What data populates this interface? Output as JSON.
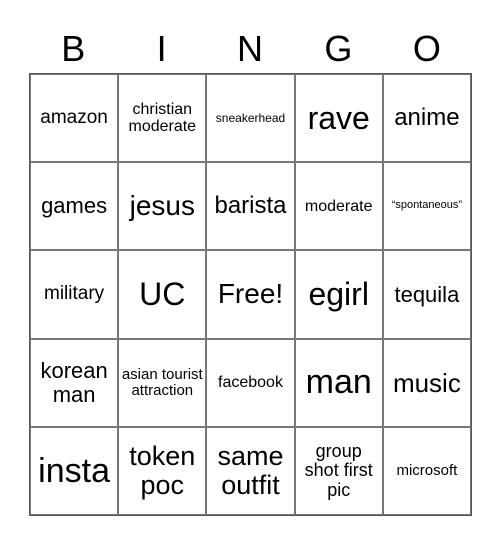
{
  "title_letters": [
    "B",
    "I",
    "N",
    "G",
    "O"
  ],
  "cells": [
    {
      "text": "amazon",
      "size": 19
    },
    {
      "text": "christian moderate",
      "size": 16
    },
    {
      "text": "sneakerhead",
      "size": 12
    },
    {
      "text": "rave",
      "size": 32
    },
    {
      "text": "anime",
      "size": 24
    },
    {
      "text": "games",
      "size": 22
    },
    {
      "text": "jesus",
      "size": 28
    },
    {
      "text": "barista",
      "size": 24
    },
    {
      "text": "moderate",
      "size": 16
    },
    {
      "text": "“spontaneous”",
      "size": 11
    },
    {
      "text": "military",
      "size": 19
    },
    {
      "text": "UC",
      "size": 32
    },
    {
      "text": "Free!",
      "size": 28
    },
    {
      "text": "egirl",
      "size": 32
    },
    {
      "text": "tequila",
      "size": 22
    },
    {
      "text": "korean man",
      "size": 22
    },
    {
      "text": "asian tourist attraction",
      "size": 15
    },
    {
      "text": "facebook",
      "size": 16
    },
    {
      "text": "man",
      "size": 34
    },
    {
      "text": "music",
      "size": 26
    },
    {
      "text": "insta",
      "size": 34
    },
    {
      "text": "token poc",
      "size": 27
    },
    {
      "text": "same outfit",
      "size": 27
    },
    {
      "text": "group shot first pic",
      "size": 18
    },
    {
      "text": "microsoft",
      "size": 15
    }
  ]
}
